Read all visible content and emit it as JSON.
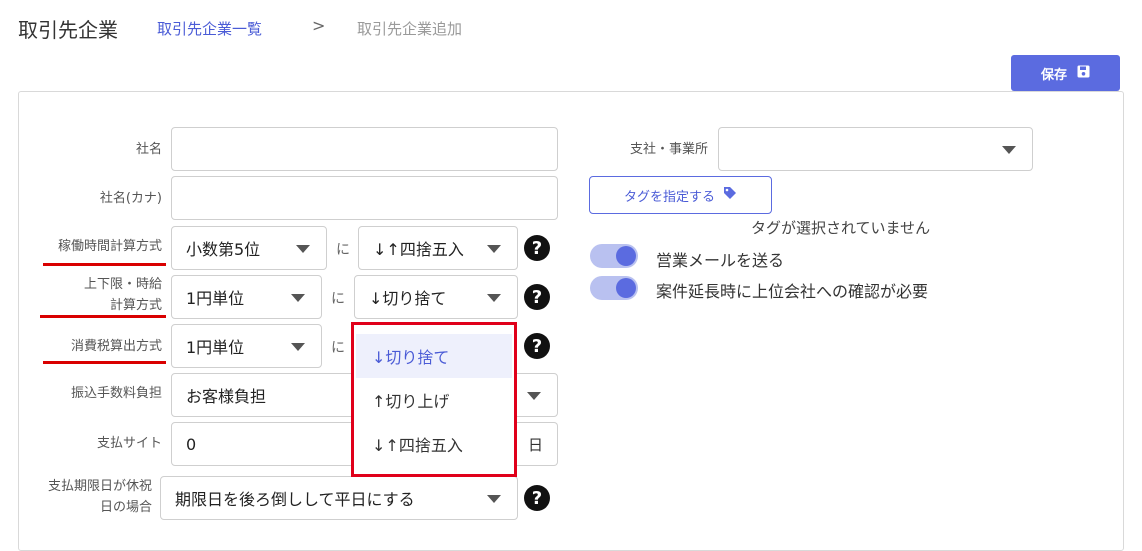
{
  "header": {
    "title": "取引先企業",
    "breadcrumb_link": "取引先企業一覧",
    "breadcrumb_separator": ">",
    "breadcrumb_current": "取引先企業追加"
  },
  "toolbar": {
    "save_label": "保存",
    "save_icon": "floppy-disk-icon"
  },
  "form": {
    "company_name_label": "社名",
    "company_name_value": "",
    "company_kana_label": "社名(カナ)",
    "company_kana_value": "",
    "work_time_label": "稼働時間計算方式",
    "work_time_unit": "小数第5位",
    "work_time_conjunction": "に",
    "work_time_rounding": "↓↑四捨五入",
    "upper_lower_label_line1": "上下限・時給",
    "upper_lower_label_line2": "計算方式",
    "upper_lower_unit": "1円単位",
    "upper_lower_conjunction": "に",
    "upper_lower_rounding": "↓切り捨て",
    "tax_label": "消費税算出方式",
    "tax_unit": "1円単位",
    "tax_conjunction": "に",
    "transfer_fee_label": "振込手数料負担",
    "transfer_fee_value": "お客様負担",
    "payment_site_label": "支払サイト",
    "payment_site_value": "0",
    "payment_site_unit": "日",
    "holiday_label_line1": "支払期限日が休祝",
    "holiday_label_line2": "日の場合",
    "holiday_value": "期限日を後ろ倒しして平日にする",
    "help_glyph": "?"
  },
  "right": {
    "branch_label": "支社・事業所",
    "branch_value": "",
    "tag_button_label": "タグを指定する",
    "tag_icon": "tag-icon",
    "no_tag_text": "タグが選択されていません",
    "toggle_sales_mail": "営業メールを送る",
    "toggle_extension_confirm": "案件延長時に上位会社への確認が必要"
  },
  "dropdown": {
    "options": [
      "↓切り捨て",
      "↑切り上げ",
      "↓↑四捨五入"
    ]
  },
  "colors": {
    "accent": "#5b6be0",
    "highlight_border": "#e0001a",
    "underline": "#d90000"
  }
}
